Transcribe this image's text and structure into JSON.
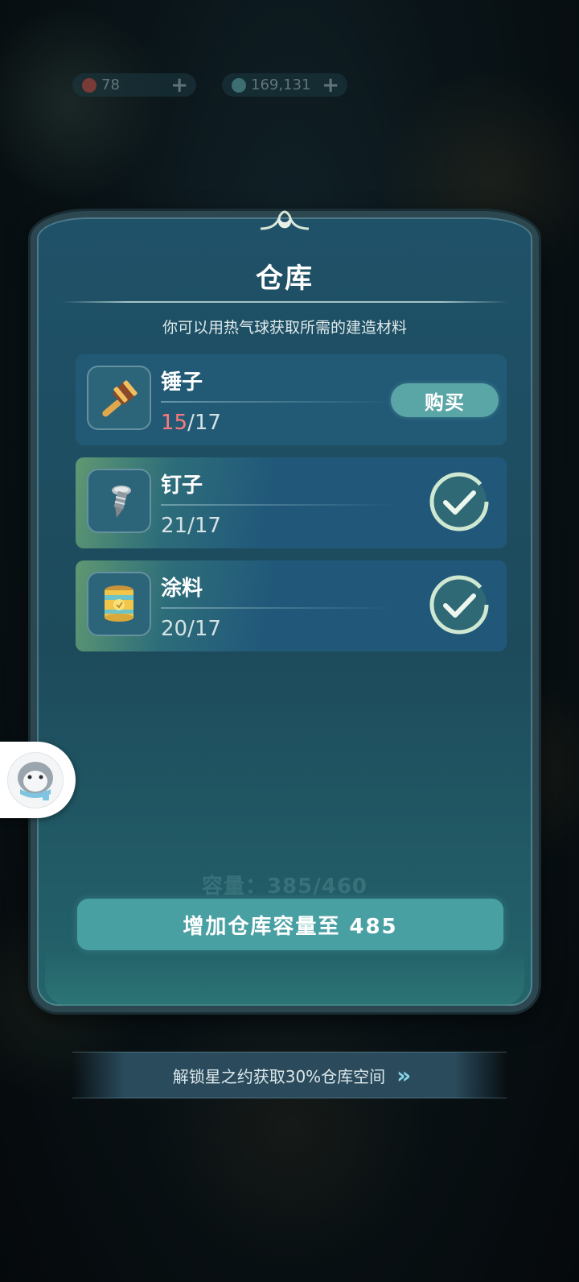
{
  "currencies": [
    {
      "icon": "ruby-icon",
      "value": "78",
      "plus": "+"
    },
    {
      "icon": "gem-icon",
      "value": "169,131",
      "plus": "+"
    }
  ],
  "warehouse": {
    "title": "仓库",
    "subtitle": "你可以用热气球获取所需的建造材料",
    "items": [
      {
        "name": "锤子",
        "have": "15",
        "need": "/17",
        "icon": "hammer-icon",
        "action": "购买",
        "complete": false
      },
      {
        "name": "钉子",
        "have": "21",
        "need": "/17",
        "icon": "nail-icon",
        "complete": true
      },
      {
        "name": "涂料",
        "have": "20",
        "need": "/17",
        "icon": "paint-bucket-icon",
        "complete": true
      }
    ],
    "capacity_text": "容量：385/460",
    "expand_button": "增加仓库容量至 485"
  },
  "banner": {
    "text": "解锁星之约获取30%仓库空间",
    "arrow": "»"
  },
  "colors": {
    "panel": "#1f5168",
    "accent": "#49a0a3",
    "shortage": "#ff7a7a"
  }
}
